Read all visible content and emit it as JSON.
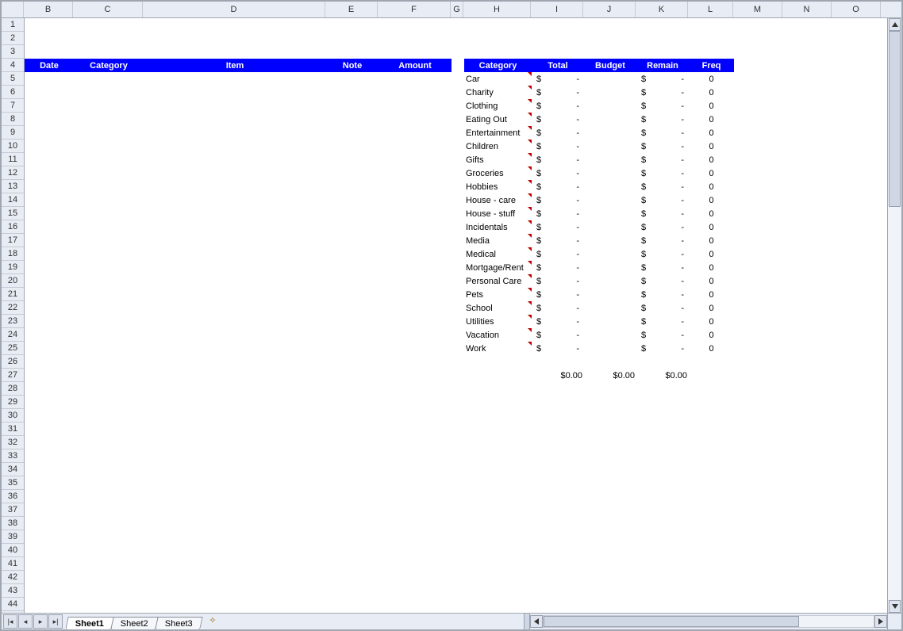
{
  "columns": [
    "B",
    "C",
    "D",
    "E",
    "F",
    "G",
    "H",
    "I",
    "J",
    "K",
    "L",
    "M",
    "N",
    "O"
  ],
  "row_start": 1,
  "row_end": 44,
  "left_headers": [
    "Date",
    "Category",
    "Item",
    "Note",
    "Amount"
  ],
  "right_headers": [
    "Category",
    "Total",
    "Budget",
    "Remain",
    "Freq"
  ],
  "summary": [
    {
      "category": "Car",
      "total": "$       -",
      "budget": "",
      "remain": "$       -",
      "freq": "0"
    },
    {
      "category": "Charity",
      "total": "$       -",
      "budget": "",
      "remain": "$       -",
      "freq": "0"
    },
    {
      "category": "Clothing",
      "total": "$       -",
      "budget": "",
      "remain": "$       -",
      "freq": "0"
    },
    {
      "category": "Eating Out",
      "total": "$       -",
      "budget": "",
      "remain": "$       -",
      "freq": "0"
    },
    {
      "category": "Entertainment",
      "total": "$       -",
      "budget": "",
      "remain": "$       -",
      "freq": "0"
    },
    {
      "category": "Children",
      "total": "$       -",
      "budget": "",
      "remain": "$       -",
      "freq": "0"
    },
    {
      "category": "Gifts",
      "total": "$       -",
      "budget": "",
      "remain": "$       -",
      "freq": "0"
    },
    {
      "category": "Groceries",
      "total": "$       -",
      "budget": "",
      "remain": "$       -",
      "freq": "0"
    },
    {
      "category": "Hobbies",
      "total": "$       -",
      "budget": "",
      "remain": "$       -",
      "freq": "0"
    },
    {
      "category": "House - care",
      "total": "$       -",
      "budget": "",
      "remain": "$       -",
      "freq": "0"
    },
    {
      "category": "House - stuff",
      "total": "$       -",
      "budget": "",
      "remain": "$       -",
      "freq": "0"
    },
    {
      "category": "Incidentals",
      "total": "$       -",
      "budget": "",
      "remain": "$       -",
      "freq": "0"
    },
    {
      "category": "Media",
      "total": "$       -",
      "budget": "",
      "remain": "$       -",
      "freq": "0"
    },
    {
      "category": "Medical",
      "total": "$       -",
      "budget": "",
      "remain": "$       -",
      "freq": "0"
    },
    {
      "category": "Mortgage/Rent",
      "total": "$       -",
      "budget": "",
      "remain": "$       -",
      "freq": "0"
    },
    {
      "category": "Personal Care",
      "total": "$       -",
      "budget": "",
      "remain": "$       -",
      "freq": "0"
    },
    {
      "category": "Pets",
      "total": "$       -",
      "budget": "",
      "remain": "$       -",
      "freq": "0"
    },
    {
      "category": "School",
      "total": "$       -",
      "budget": "",
      "remain": "$       -",
      "freq": "0"
    },
    {
      "category": "Utilities",
      "total": "$       -",
      "budget": "",
      "remain": "$       -",
      "freq": "0"
    },
    {
      "category": "Vacation",
      "total": "$       -",
      "budget": "",
      "remain": "$       -",
      "freq": "0"
    },
    {
      "category": "Work",
      "total": "$       -",
      "budget": "",
      "remain": "$       -",
      "freq": "0"
    }
  ],
  "totals": {
    "total": "$0.00",
    "budget": "$0.00",
    "remain": "$0.00"
  },
  "sheet_tabs": [
    "Sheet1",
    "Sheet2",
    "Sheet3"
  ],
  "active_tab": 0
}
